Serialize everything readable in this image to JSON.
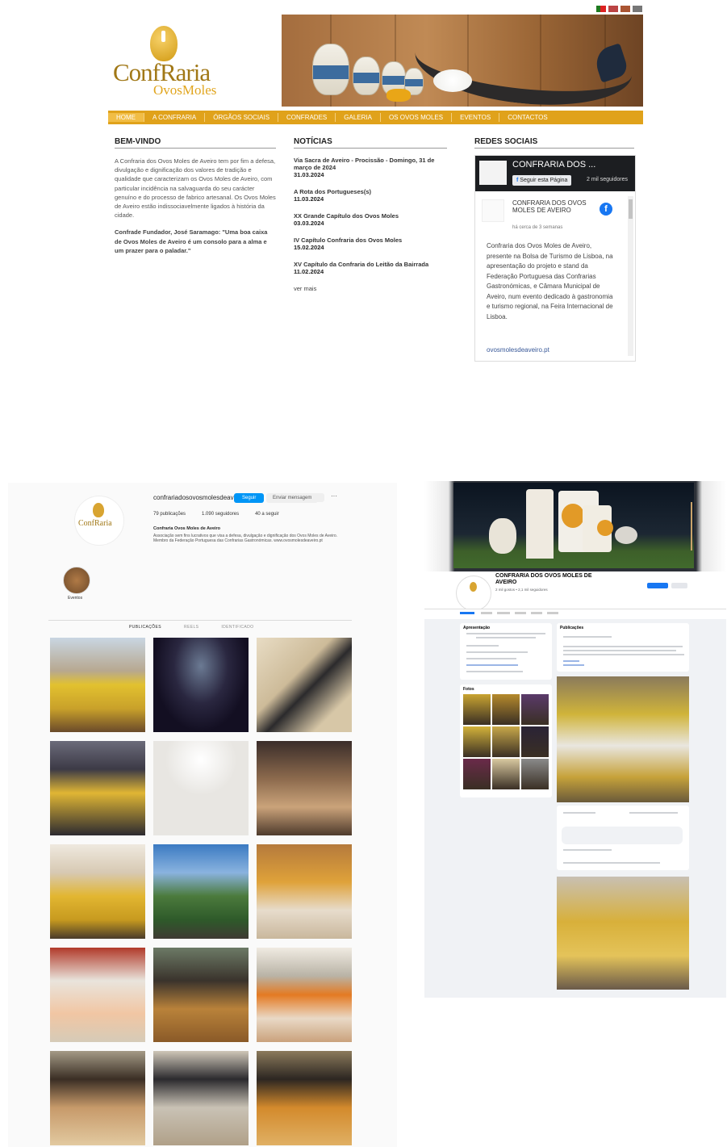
{
  "website": {
    "logo_main": "ConfRaria",
    "logo_sub": "OvosMoles",
    "nav": [
      "HOME",
      "A CONFRARIA",
      "ÓRGÃOS SOCIAIS",
      "CONFRADES",
      "GALERIA",
      "OS OVOS MOLES",
      "EVENTOS",
      "CONTACTOS"
    ],
    "welcome": {
      "heading": "BEM-VINDO",
      "para1": "A Confraria dos Ovos Moles de Aveiro tem por fim a defesa, divulgação e dignificação dos valores de tradição e qualidade que caracterizam os Ovos Moles de Aveiro, com particular incidência na salvaguarda do seu carácter genuíno e do processo de fabrico artesanal. Os Ovos Moles de Aveiro estão indissociavelmente ligados à história da cidade.",
      "para2": "Confrade Fundador, José Saramago: \"Uma boa caixa de Ovos Moles de Aveiro é um consolo para a alma e um prazer para o paladar.\""
    },
    "news": {
      "heading": "NOTÍCIAS",
      "items": [
        {
          "title": "Via Sacra de Aveiro - Procissão - Domingo, 31 de março de 2024",
          "date": "31.03.2024"
        },
        {
          "title": "A Rota dos Portugueses(s)",
          "date": "11.03.2024"
        },
        {
          "title": "XX Grande Capítulo dos Ovos Moles",
          "date": "03.03.2024"
        },
        {
          "title": "IV Capítulo Confraria dos Ovos Moles",
          "date": "15.02.2024"
        },
        {
          "title": "XV Capítulo da Confraria do Leitão da Bairrada",
          "date": "11.02.2024"
        }
      ],
      "more": "ver mais"
    },
    "social": {
      "heading": "REDES SOCIAIS",
      "fb_name": "CONFRARIA DOS ...",
      "fb_button": "Seguir esta Página",
      "fb_followers": "2 mil seguidores",
      "card_name": "CONFRARIA DOS OVOS MOLES DE AVEIRO",
      "card_sub": "há cerca de 3 semanas",
      "card_text": "Confraria dos Ovos Moles de Aveiro, presente na Bolsa de Turismo de Lisboa, na apresentação do projeto e stand da Federação Portuguesa das Confrarias Gastronómicas, e Câmara Municipal de Aveiro, num evento dedicado à gastronomia e turismo regional, na Feira Internacional de Lisboa.",
      "card_link": "ovosmolesdeaveiro.pt"
    }
  },
  "instagram": {
    "username": "confrariadosovosmolesdeaveiro",
    "follow": "Seguir",
    "message": "Enviar mensagem",
    "stats": [
      "79 publicações",
      "1.090 seguidores",
      "40 a seguir"
    ],
    "bio_name": "Confraria Ovos Moles de Aveiro",
    "bio": "Associação sem fins lucrativos que visa a defesa, divulgação e dignificação dos Ovos Moles de Aveiro. Membro da Federação Portuguesa das Confrarias Gastronómicas. www.ovosmolesdeaveiro.pt",
    "highlight_label": "Eventos",
    "tabs": [
      "PUBLICAÇÕES",
      "REELS",
      "IDENTIFICADO"
    ]
  },
  "facebook": {
    "page_name": "CONFRARIA DOS OVOS MOLES DE AVEIRO",
    "likes": "2 mil gostos • 2,1 mil seguidores",
    "intro_title": "Apresentação",
    "photos_title": "Fotos",
    "posts_title": "Publicações"
  },
  "colors": {
    "brand": "#e0a21b",
    "fb_blue": "#1877f2",
    "ig_blue": "#0095f6"
  }
}
